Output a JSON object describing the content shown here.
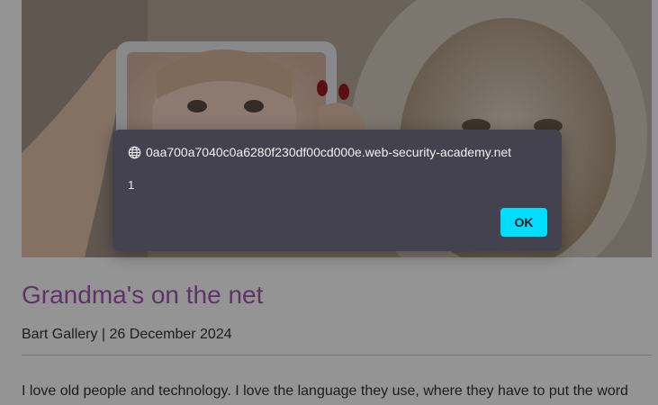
{
  "post": {
    "title": "Grandma's on the net",
    "author": "Bart Gallery",
    "separator": "|",
    "date": "26 December 2024",
    "body_first_line": "I love old people and technology. I love the language they use, where they have to put the word"
  },
  "dialog": {
    "origin": "0aa700a7040c0a6280f230df00cd000e.web-security-academy.net",
    "message": "1",
    "ok_label": "OK",
    "icon": "globe-icon"
  },
  "colors": {
    "title": "#a35bb3",
    "dialog_bg": "#44424e",
    "ok_button": "#00ddff"
  }
}
